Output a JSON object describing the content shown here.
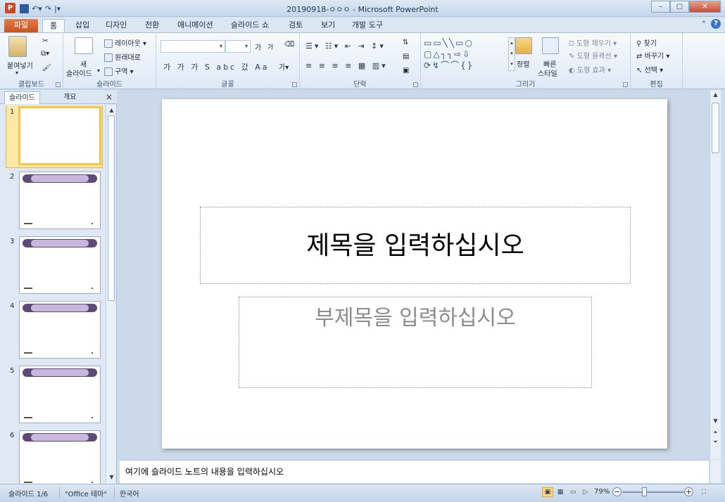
{
  "window": {
    "title": "20190918-ㅇㅇㅇ - Microsoft PowerPoint",
    "minimize": "–",
    "maximize": "▢",
    "close": "✕"
  },
  "tabs": [
    {
      "label": "파일"
    },
    {
      "label": "홈"
    },
    {
      "label": "삽입"
    },
    {
      "label": "디자인"
    },
    {
      "label": "전환"
    },
    {
      "label": "애니메이션"
    },
    {
      "label": "슬라이드 쇼"
    },
    {
      "label": "검토"
    },
    {
      "label": "보기"
    },
    {
      "label": "개발 도구"
    }
  ],
  "ribbon": {
    "clipboard": {
      "label": "클립보드",
      "paste": "붙여넣기"
    },
    "slides": {
      "label": "슬라이드",
      "new_slide_line1": "새",
      "new_slide_line2": "슬라이드",
      "layout": "레이아웃",
      "reset": "원래대로",
      "section": "구역"
    },
    "font": {
      "label": "글꼴",
      "grow": "가",
      "shrink": "가",
      "row2": "가 가 가 S abc 갔 Aa"
    },
    "paragraph": {
      "label": "단락"
    },
    "drawing": {
      "label": "그리기",
      "arrange": "정렬",
      "quick_styles_line1": "빠른",
      "quick_styles_line2": "스타일",
      "shape_fill": "도형 채우기",
      "shape_outline": "도형 윤곽선",
      "shape_effects": "도형 효과"
    },
    "editing": {
      "label": "편집",
      "find": "찾기",
      "replace": "바꾸기",
      "select": "선택"
    }
  },
  "panel": {
    "tab_slides": "슬라이드",
    "tab_outline": "개요",
    "close": "×",
    "slides": [
      {
        "num": "1",
        "selected": true,
        "decorated": false
      },
      {
        "num": "2",
        "selected": false,
        "decorated": true
      },
      {
        "num": "3",
        "selected": false,
        "decorated": true
      },
      {
        "num": "4",
        "selected": false,
        "decorated": true
      },
      {
        "num": "5",
        "selected": false,
        "decorated": true
      },
      {
        "num": "6",
        "selected": false,
        "decorated": true
      }
    ]
  },
  "slide": {
    "title_placeholder": "제목을 입력하십시오",
    "subtitle_placeholder": "부제목을 입력하십시오"
  },
  "notes": {
    "placeholder": "여기에 슬라이드 노트의 내용을 입력하십시오"
  },
  "status": {
    "slide_info": "슬라이드 1/6",
    "theme": "\"Office 테마\"",
    "language": "한국어",
    "zoom": "79%"
  }
}
